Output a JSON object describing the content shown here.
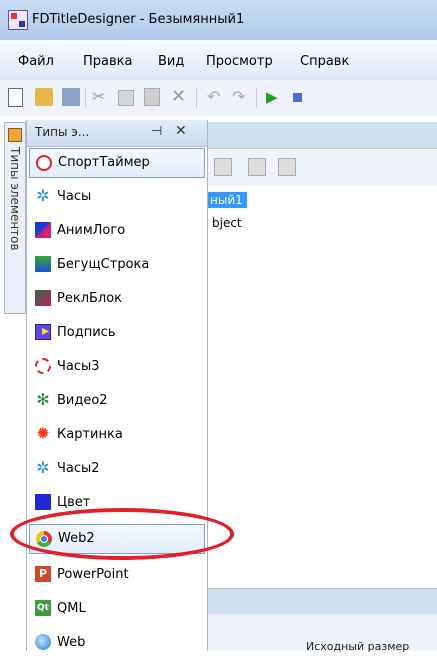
{
  "window": {
    "title": "FDTitleDesigner - Безымянный1"
  },
  "menu": [
    "Файл",
    "Правка",
    "Вид",
    "Просмотр",
    "Справк"
  ],
  "toolbox": {
    "tab_label": "Типы элементов",
    "panel_title": "Типы э...",
    "pin_glyph": "⊣",
    "close_glyph": "✕",
    "items": [
      {
        "label": "СпортТаймер",
        "icon": "stopwatch-icon"
      },
      {
        "label": "Часы",
        "icon": "clock-icon"
      },
      {
        "label": "АнимЛого",
        "icon": "anim-logo-icon"
      },
      {
        "label": "БегущСтрока",
        "icon": "marquee-icon"
      },
      {
        "label": "РеклБлок",
        "icon": "ad-block-icon"
      },
      {
        "label": "Подпись",
        "icon": "caption-icon"
      },
      {
        "label": "Часы3",
        "icon": "clock3-icon"
      },
      {
        "label": "Видео2",
        "icon": "video-icon"
      },
      {
        "label": "Картинка",
        "icon": "picture-icon"
      },
      {
        "label": "Часы2",
        "icon": "clock2-icon"
      },
      {
        "label": "Цвет",
        "icon": "color-icon"
      },
      {
        "label": "Web2",
        "icon": "chrome-icon"
      },
      {
        "label": "PowerPoint",
        "icon": "powerpoint-icon"
      },
      {
        "label": "QML",
        "icon": "qml-icon"
      },
      {
        "label": "Web",
        "icon": "web-icon"
      }
    ]
  },
  "document": {
    "tree_selected": "ный1",
    "tree_item": "bject",
    "bottom_text": "Исходный размер"
  },
  "icon_glyphs": {
    "clock": "✲",
    "video": "✻",
    "picture": "✹",
    "ppt": "P",
    "qml": "Qt",
    "cut": "✂",
    "delete": "✕",
    "undo": "↶",
    "redo": "↷",
    "play": "▶"
  },
  "annotation": {
    "color": "#e0212a",
    "target": "Web2"
  }
}
